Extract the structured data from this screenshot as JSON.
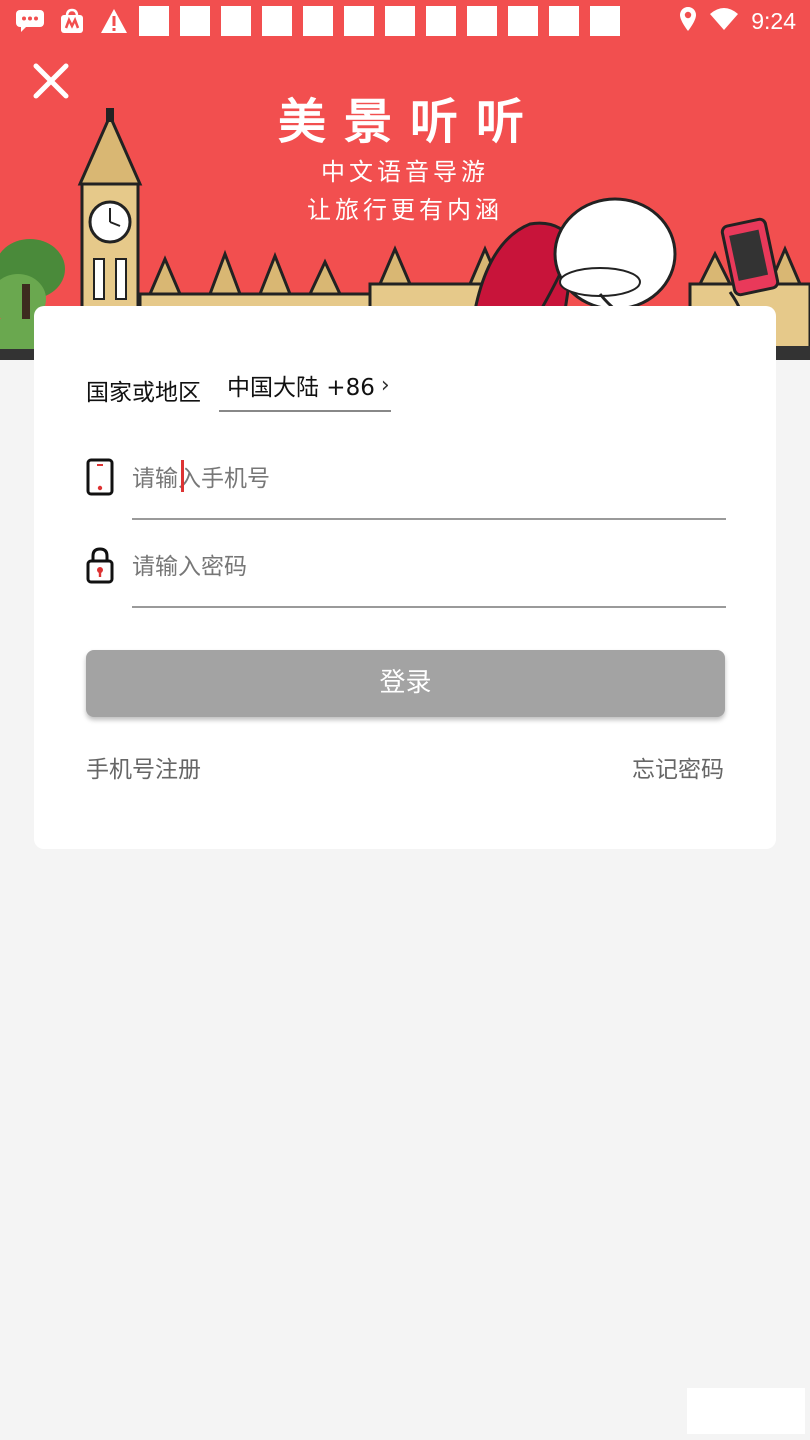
{
  "status_bar": {
    "time": "9:24",
    "icons": [
      "message-icon",
      "shopping-bag-icon",
      "warning-icon",
      "location-icon",
      "wifi-icon"
    ],
    "placeholder_square_count": 12
  },
  "banner": {
    "title": "美景听听",
    "subtitle_line1": "中文语音导游",
    "subtitle_line2": "让旅行更有内涵",
    "close_icon": "close-icon",
    "background_color": "#f24f4f"
  },
  "form": {
    "region_label": "国家或地区",
    "region_value": "中国大陆 +86",
    "phone_placeholder": "请输入手机号",
    "password_placeholder": "请输入密码",
    "login_label": "登录",
    "register_link": "手机号注册",
    "forgot_link": "忘记密码"
  },
  "colors": {
    "accent": "#f24f4f",
    "button_disabled": "#a3a3a3",
    "cursor": "#dd3333"
  }
}
